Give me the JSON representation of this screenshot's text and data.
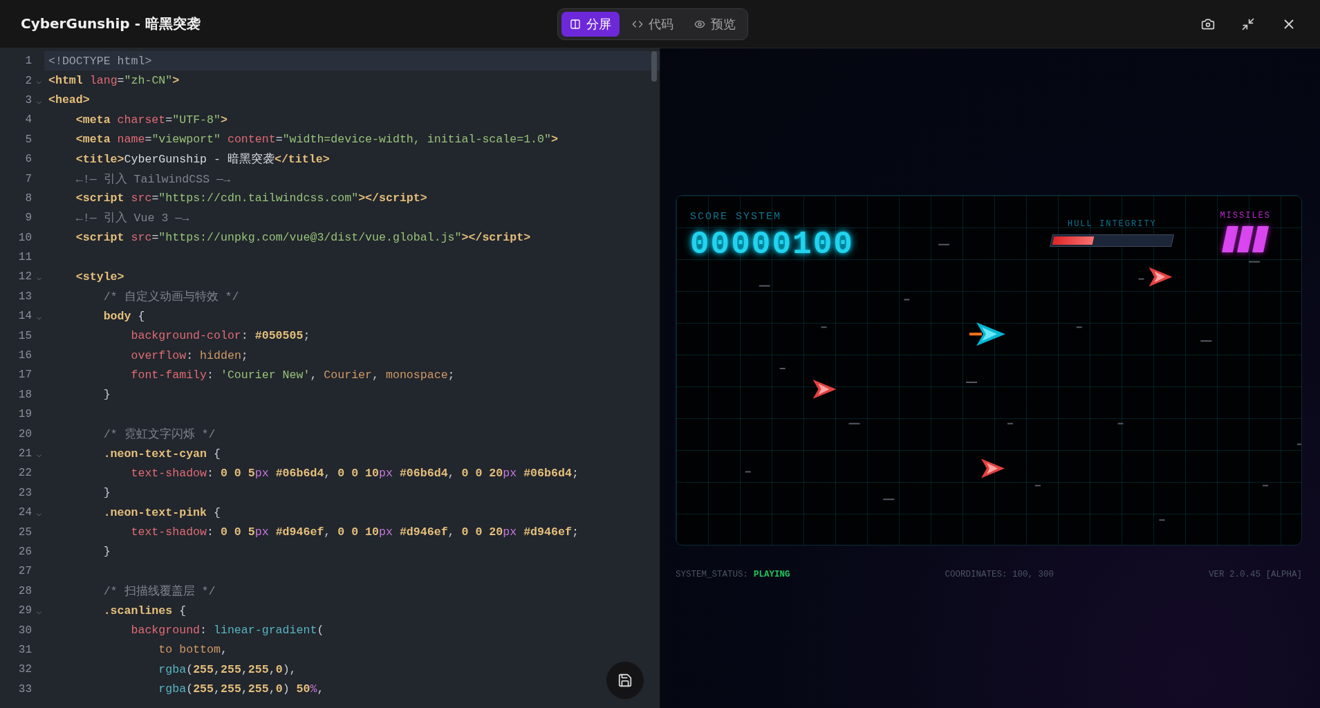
{
  "window": {
    "title": "CyberGunship - 暗黑突袭"
  },
  "view_tabs": [
    {
      "label": "分屏",
      "selected": true
    },
    {
      "label": "代码",
      "selected": false
    },
    {
      "label": "预览",
      "selected": false
    }
  ],
  "editor": {
    "lines": [
      {
        "n": "1",
        "fold": false,
        "active": true,
        "tokens": [
          {
            "kind": "doctype",
            "text": "<!DOCTYPE html>"
          }
        ]
      },
      {
        "n": "2",
        "fold": true,
        "active": false,
        "tokens": [
          {
            "kind": "tag",
            "text": "<html"
          },
          {
            "kind": "attr",
            "text": " lang"
          },
          {
            "kind": "punct",
            "text": "="
          },
          {
            "kind": "string",
            "text": "\"zh-CN\""
          },
          {
            "kind": "tag",
            "text": ">"
          }
        ]
      },
      {
        "n": "3",
        "fold": true,
        "active": false,
        "tokens": [
          {
            "kind": "tag",
            "text": "<head>"
          }
        ]
      },
      {
        "n": "4",
        "fold": false,
        "active": false,
        "tokens": [
          {
            "kind": "tag",
            "text": "    <meta"
          },
          {
            "kind": "attr",
            "text": " charset"
          },
          {
            "kind": "punct",
            "text": "="
          },
          {
            "kind": "string",
            "text": "\"UTF-8\""
          },
          {
            "kind": "tag",
            "text": ">"
          }
        ]
      },
      {
        "n": "5",
        "fold": false,
        "active": false,
        "tokens": [
          {
            "kind": "tag",
            "text": "    <meta"
          },
          {
            "kind": "attr",
            "text": " name"
          },
          {
            "kind": "punct",
            "text": "="
          },
          {
            "kind": "string",
            "text": "\"viewport\""
          },
          {
            "kind": "attr",
            "text": " content"
          },
          {
            "kind": "punct",
            "text": "="
          },
          {
            "kind": "string",
            "text": "\"width=device-width, initial-scale=1.0\""
          },
          {
            "kind": "tag",
            "text": ">"
          }
        ]
      },
      {
        "n": "6",
        "fold": false,
        "active": false,
        "tokens": [
          {
            "kind": "tag",
            "text": "    <title>"
          },
          {
            "kind": "plain",
            "text": "CyberGunship - 暗黑突袭"
          },
          {
            "kind": "tag",
            "text": "</title>"
          }
        ]
      },
      {
        "n": "7",
        "fold": false,
        "active": false,
        "tokens": [
          {
            "kind": "comment",
            "text": "    ←!— 引入 TailwindCSS —→"
          }
        ]
      },
      {
        "n": "8",
        "fold": false,
        "active": false,
        "tokens": [
          {
            "kind": "tag",
            "text": "    <script"
          },
          {
            "kind": "attr",
            "text": " src"
          },
          {
            "kind": "punct",
            "text": "="
          },
          {
            "kind": "string",
            "text": "\"https://cdn.tailwindcss.com\""
          },
          {
            "kind": "tag",
            "text": "></script>"
          }
        ]
      },
      {
        "n": "9",
        "fold": false,
        "active": false,
        "tokens": [
          {
            "kind": "comment",
            "text": "    ←!— 引入 Vue 3 —→"
          }
        ]
      },
      {
        "n": "10",
        "fold": false,
        "active": false,
        "tokens": [
          {
            "kind": "tag",
            "text": "    <script"
          },
          {
            "kind": "attr",
            "text": " src"
          },
          {
            "kind": "punct",
            "text": "="
          },
          {
            "kind": "string",
            "text": "\"https://unpkg.com/vue@3/dist/vue.global.js\""
          },
          {
            "kind": "tag",
            "text": "></script>"
          }
        ]
      },
      {
        "n": "11",
        "fold": false,
        "active": false
      },
      {
        "n": "12",
        "fold": true,
        "active": false,
        "tokens": [
          {
            "kind": "tag",
            "text": "    <style>"
          }
        ]
      },
      {
        "n": "13",
        "fold": false,
        "active": false,
        "tokens": [
          {
            "kind": "comment",
            "text": "        /* 自定义动画与特效 */"
          }
        ]
      },
      {
        "n": "14",
        "fold": true,
        "active": false,
        "tokens": [
          {
            "kind": "selector",
            "text": "        body"
          },
          {
            "kind": "punct",
            "text": " {"
          }
        ]
      },
      {
        "n": "15",
        "fold": false,
        "active": false,
        "tokens": [
          {
            "kind": "prop",
            "text": "            background-color"
          },
          {
            "kind": "punct",
            "text": ": "
          },
          {
            "kind": "number",
            "text": "#050505"
          },
          {
            "kind": "punct",
            "text": ";"
          }
        ]
      },
      {
        "n": "16",
        "fold": false,
        "active": false,
        "tokens": [
          {
            "kind": "prop",
            "text": "            overflow"
          },
          {
            "kind": "punct",
            "text": ": "
          },
          {
            "kind": "value",
            "text": "hidden"
          },
          {
            "kind": "punct",
            "text": ";"
          }
        ]
      },
      {
        "n": "17",
        "fold": false,
        "active": false,
        "tokens": [
          {
            "kind": "prop",
            "text": "            font-family"
          },
          {
            "kind": "punct",
            "text": ": "
          },
          {
            "kind": "string",
            "text": "'Courier New'"
          },
          {
            "kind": "punct",
            "text": ", "
          },
          {
            "kind": "value",
            "text": "Courier"
          },
          {
            "kind": "punct",
            "text": ", "
          },
          {
            "kind": "value",
            "text": "monospace"
          },
          {
            "kind": "punct",
            "text": ";"
          }
        ]
      },
      {
        "n": "18",
        "fold": false,
        "active": false,
        "tokens": [
          {
            "kind": "punct",
            "text": "        }"
          }
        ]
      },
      {
        "n": "19",
        "fold": false,
        "active": false
      },
      {
        "n": "20",
        "fold": false,
        "active": false,
        "tokens": [
          {
            "kind": "comment",
            "text": "        /* 霓虹文字闪烁 */"
          }
        ]
      },
      {
        "n": "21",
        "fold": true,
        "active": false,
        "tokens": [
          {
            "kind": "selector",
            "text": "        .neon-text-cyan"
          },
          {
            "kind": "punct",
            "text": " {"
          }
        ]
      },
      {
        "n": "22",
        "fold": false,
        "active": false,
        "tokens": [
          {
            "kind": "prop",
            "text": "            text-shadow"
          },
          {
            "kind": "punct",
            "text": ": "
          },
          {
            "kind": "number",
            "text": "0 0 5"
          },
          {
            "kind": "unit",
            "text": "px"
          },
          {
            "kind": "number",
            "text": " #06b6d4"
          },
          {
            "kind": "punct",
            "text": ", "
          },
          {
            "kind": "number",
            "text": "0 0 10"
          },
          {
            "kind": "unit",
            "text": "px"
          },
          {
            "kind": "number",
            "text": " #06b6d4"
          },
          {
            "kind": "punct",
            "text": ", "
          },
          {
            "kind": "number",
            "text": "0 0 20"
          },
          {
            "kind": "unit",
            "text": "px"
          },
          {
            "kind": "number",
            "text": " #06b6d4"
          },
          {
            "kind": "punct",
            "text": ";"
          }
        ]
      },
      {
        "n": "23",
        "fold": false,
        "active": false,
        "tokens": [
          {
            "kind": "punct",
            "text": "        }"
          }
        ]
      },
      {
        "n": "24",
        "fold": true,
        "active": false,
        "tokens": [
          {
            "kind": "selector",
            "text": "        .neon-text-pink"
          },
          {
            "kind": "punct",
            "text": " {"
          }
        ]
      },
      {
        "n": "25",
        "fold": false,
        "active": false,
        "tokens": [
          {
            "kind": "prop",
            "text": "            text-shadow"
          },
          {
            "kind": "punct",
            "text": ": "
          },
          {
            "kind": "number",
            "text": "0 0 5"
          },
          {
            "kind": "unit",
            "text": "px"
          },
          {
            "kind": "number",
            "text": " #d946ef"
          },
          {
            "kind": "punct",
            "text": ", "
          },
          {
            "kind": "number",
            "text": "0 0 10"
          },
          {
            "kind": "unit",
            "text": "px"
          },
          {
            "kind": "number",
            "text": " #d946ef"
          },
          {
            "kind": "punct",
            "text": ", "
          },
          {
            "kind": "number",
            "text": "0 0 20"
          },
          {
            "kind": "unit",
            "text": "px"
          },
          {
            "kind": "number",
            "text": " #d946ef"
          },
          {
            "kind": "punct",
            "text": ";"
          }
        ]
      },
      {
        "n": "26",
        "fold": false,
        "active": false,
        "tokens": [
          {
            "kind": "punct",
            "text": "        }"
          }
        ]
      },
      {
        "n": "27",
        "fold": false,
        "active": false
      },
      {
        "n": "28",
        "fold": false,
        "active": false,
        "tokens": [
          {
            "kind": "comment",
            "text": "        /* 扫描线覆盖层 */"
          }
        ]
      },
      {
        "n": "29",
        "fold": true,
        "active": false,
        "tokens": [
          {
            "kind": "selector",
            "text": "        .scanlines"
          },
          {
            "kind": "punct",
            "text": " {"
          }
        ]
      },
      {
        "n": "30",
        "fold": false,
        "active": false,
        "tokens": [
          {
            "kind": "prop",
            "text": "            background"
          },
          {
            "kind": "punct",
            "text": ": "
          },
          {
            "kind": "func",
            "text": "linear-gradient"
          },
          {
            "kind": "punct",
            "text": "("
          }
        ]
      },
      {
        "n": "31",
        "fold": false,
        "active": false,
        "tokens": [
          {
            "kind": "value",
            "text": "                to bottom"
          },
          {
            "kind": "punct",
            "text": ","
          }
        ]
      },
      {
        "n": "32",
        "fold": false,
        "active": false,
        "tokens": [
          {
            "kind": "func",
            "text": "                rgba"
          },
          {
            "kind": "punct",
            "text": "("
          },
          {
            "kind": "number",
            "text": "255"
          },
          {
            "kind": "punct",
            "text": ","
          },
          {
            "kind": "number",
            "text": "255"
          },
          {
            "kind": "punct",
            "text": ","
          },
          {
            "kind": "number",
            "text": "255"
          },
          {
            "kind": "punct",
            "text": ","
          },
          {
            "kind": "number",
            "text": "0"
          },
          {
            "kind": "punct",
            "text": "),"
          }
        ]
      },
      {
        "n": "33",
        "fold": false,
        "active": false,
        "tokens": [
          {
            "kind": "func",
            "text": "                rgba"
          },
          {
            "kind": "punct",
            "text": "("
          },
          {
            "kind": "number",
            "text": "255"
          },
          {
            "kind": "punct",
            "text": ","
          },
          {
            "kind": "number",
            "text": "255"
          },
          {
            "kind": "punct",
            "text": ","
          },
          {
            "kind": "number",
            "text": "255"
          },
          {
            "kind": "punct",
            "text": ","
          },
          {
            "kind": "number",
            "text": "0"
          },
          {
            "kind": "punct",
            "text": ") "
          },
          {
            "kind": "number",
            "text": "50"
          },
          {
            "kind": "unit",
            "text": "%"
          },
          {
            "kind": "punct",
            "text": ","
          }
        ]
      }
    ]
  },
  "game": {
    "score_label": "SCORE SYSTEM",
    "score": "00000100",
    "hull": {
      "label": "HULL INTEGRITY",
      "level": 0.34
    },
    "missiles": {
      "label": "MISSILES",
      "slots": [
        {
          "loaded": true
        },
        {
          "loaded": true
        },
        {
          "loaded": true
        }
      ]
    }
  },
  "status_bar": {
    "status_label": "SYSTEM_STATUS:",
    "status": "PLAYING",
    "coordinates": "COORDINATES: 100, 300",
    "version": "VER 2.0.45 [ALPHA]"
  }
}
